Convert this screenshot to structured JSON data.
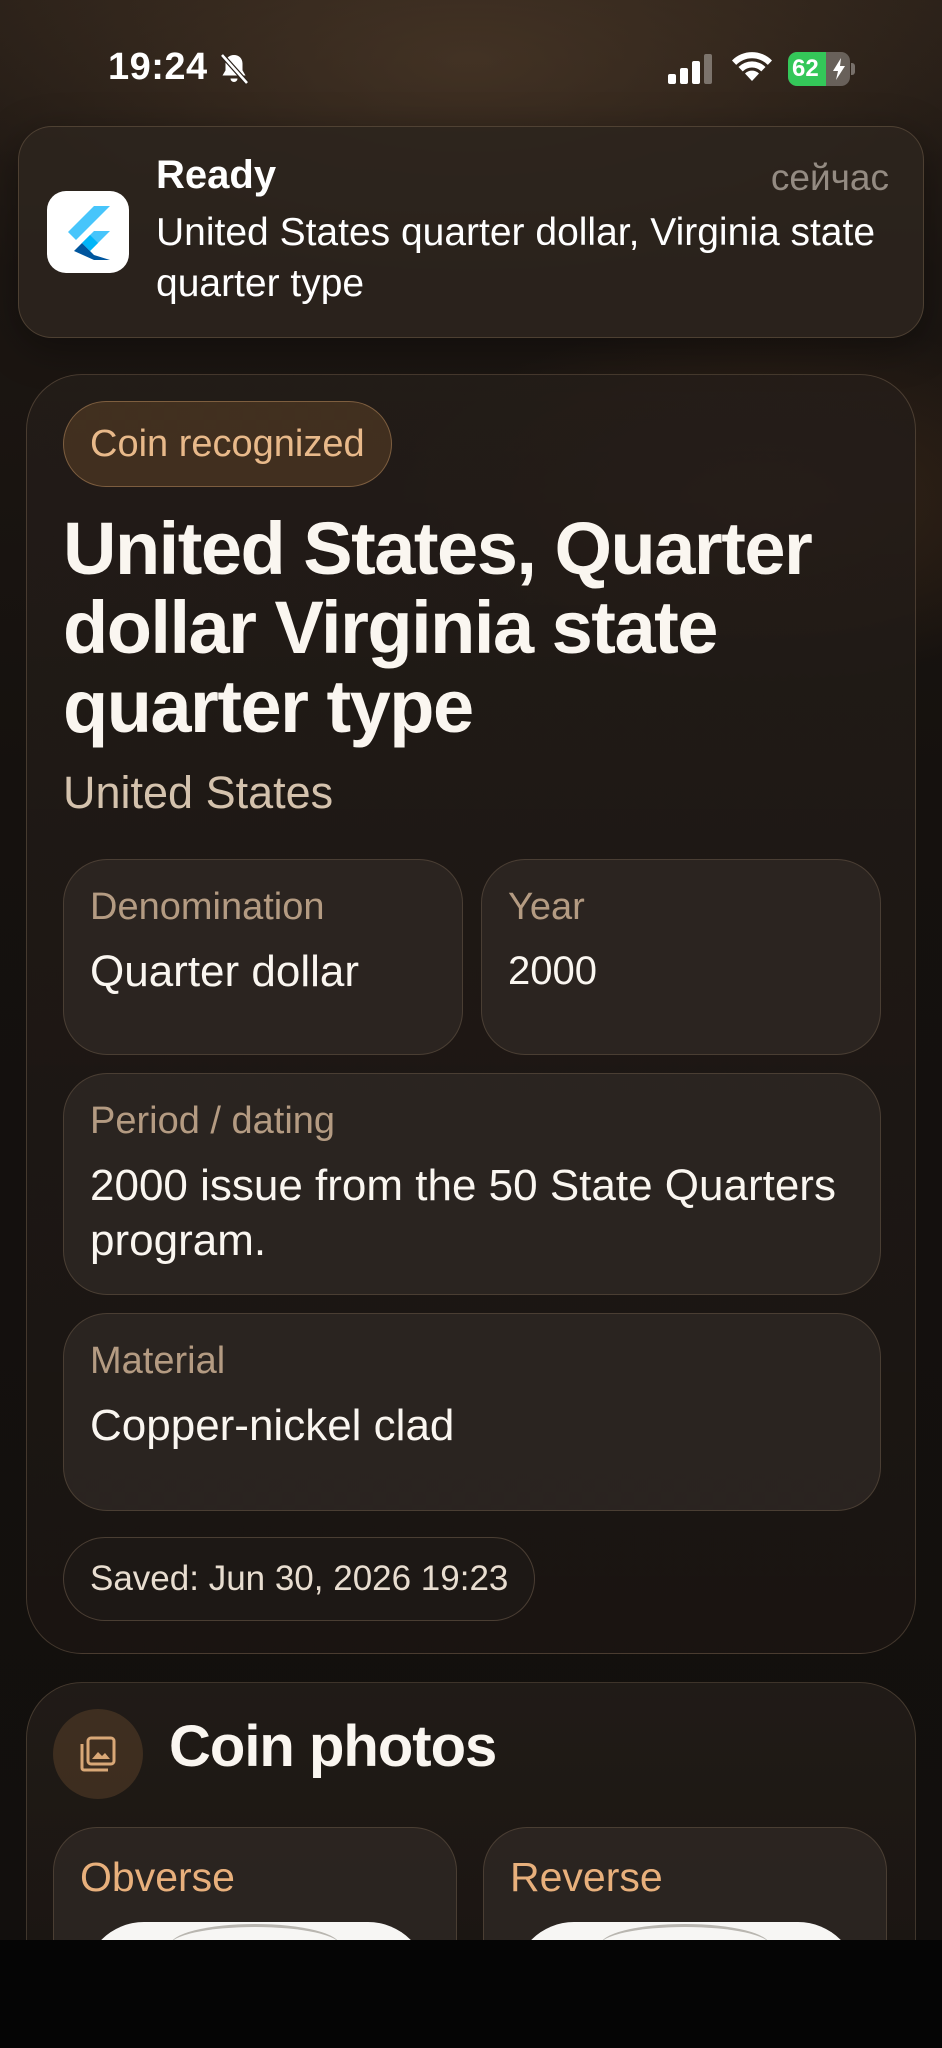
{
  "status_bar": {
    "time": "19:24",
    "battery_percent": "62",
    "battery_level": 0.62,
    "silent_mode_icon": "bell-slash-icon",
    "signal_icon": "cellular-signal-icon",
    "wifi_icon": "wifi-icon",
    "accent_color": "#34c759"
  },
  "notification": {
    "app_icon": "flutter-logo-icon",
    "title": "Ready",
    "time": "сейчас",
    "body": "United States quarter dollar, Virginia state quarter type"
  },
  "result": {
    "chip": "Coin recognized",
    "title": "United States, Quarter dollar Virginia state quarter type",
    "country": "United States",
    "fields": {
      "denomination": {
        "label": "Denomination",
        "value": "Quarter dollar"
      },
      "year": {
        "label": "Year",
        "value": "2000"
      },
      "period": {
        "label": "Period / dating",
        "value": "2000 issue from the 50 State Quarters program."
      },
      "material": {
        "label": "Material",
        "value": "Copper-nickel clad"
      }
    },
    "saved": "Saved: Jun 30, 2026 19:23"
  },
  "photos": {
    "icon": "gallery-icon",
    "title": "Coin photos",
    "obverse_label": "Obverse",
    "reverse_label": "Reverse"
  },
  "colors": {
    "accent": "#e8b98a",
    "label": "#b49b82",
    "background": "#15110e"
  }
}
